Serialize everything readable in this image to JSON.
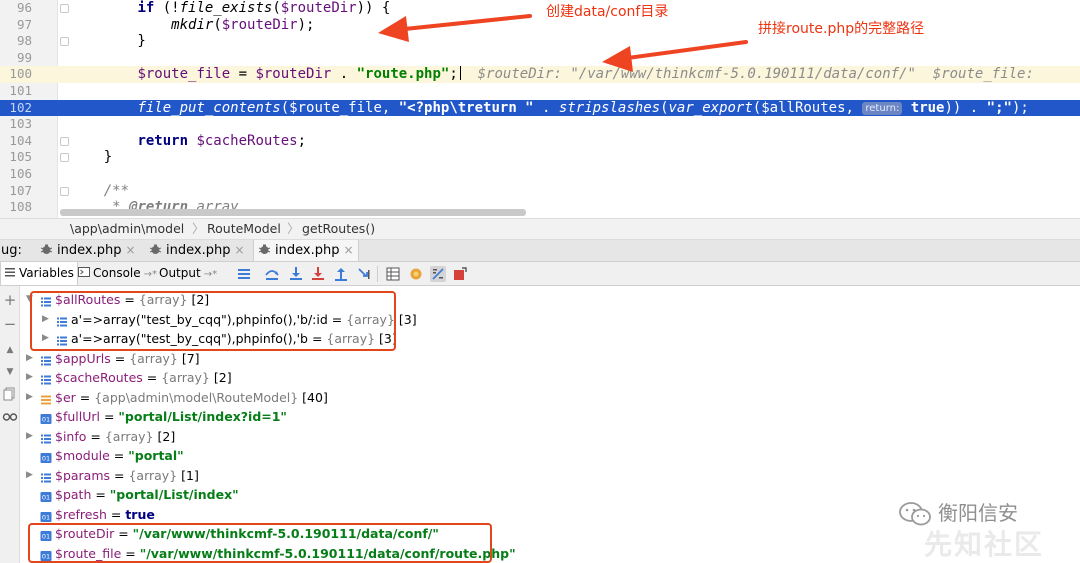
{
  "editor": {
    "lines": [
      {
        "num": "96",
        "style": "normal",
        "tokens": [
          {
            "t": "        ",
            "c": "plain"
          },
          {
            "t": "if",
            "c": "kw"
          },
          {
            "t": " (!",
            "c": "plain"
          },
          {
            "t": "file_exists",
            "c": "fn"
          },
          {
            "t": "(",
            "c": "plain"
          },
          {
            "t": "$routeDir",
            "c": "var"
          },
          {
            "t": ")) {",
            "c": "plain"
          }
        ]
      },
      {
        "num": "97",
        "style": "normal",
        "tokens": [
          {
            "t": "            ",
            "c": "plain"
          },
          {
            "t": "mkdir",
            "c": "fn"
          },
          {
            "t": "(",
            "c": "plain"
          },
          {
            "t": "$routeDir",
            "c": "var"
          },
          {
            "t": ");",
            "c": "plain"
          }
        ]
      },
      {
        "num": "98",
        "style": "normal",
        "tokens": [
          {
            "t": "        }",
            "c": "plain"
          }
        ]
      },
      {
        "num": "99",
        "style": "normal",
        "tokens": []
      },
      {
        "num": "100",
        "style": "exec",
        "tokens": [
          {
            "t": "        ",
            "c": "plain"
          },
          {
            "t": "$route_file",
            "c": "var"
          },
          {
            "t": " = ",
            "c": "plain"
          },
          {
            "t": "$routeDir",
            "c": "var"
          },
          {
            "t": " . ",
            "c": "plain"
          },
          {
            "t": "\"route.php\"",
            "c": "str"
          },
          {
            "t": ";",
            "c": "plain"
          },
          {
            "t": "",
            "c": "caret"
          },
          {
            "t": "  $routeDir: \"/var/www/thinkcmf-5.0.190111/data/conf/\"  $route_file: ",
            "c": "inline-hint"
          }
        ]
      },
      {
        "num": "101",
        "style": "normal",
        "tokens": []
      },
      {
        "num": "102",
        "style": "selected",
        "tokens": [
          {
            "t": "        ",
            "c": "plain"
          },
          {
            "t": "file_put_contents",
            "c": "fn"
          },
          {
            "t": "(",
            "c": "plain"
          },
          {
            "t": "$route_file",
            "c": "var"
          },
          {
            "t": ", ",
            "c": "plain"
          },
          {
            "t": "\"<?php\\treturn \"",
            "c": "str"
          },
          {
            "t": " . ",
            "c": "plain"
          },
          {
            "t": "stripslashes",
            "c": "fn"
          },
          {
            "t": "(",
            "c": "plain"
          },
          {
            "t": "var_export",
            "c": "fn"
          },
          {
            "t": "(",
            "c": "plain"
          },
          {
            "t": "$allRoutes",
            "c": "var"
          },
          {
            "t": ", ",
            "c": "plain"
          },
          {
            "t": "return:",
            "c": "param-hint"
          },
          {
            "t": " true",
            "c": "kw"
          },
          {
            "t": ")) . ",
            "c": "plain"
          },
          {
            "t": "\";\"",
            "c": "str"
          },
          {
            "t": ");",
            "c": "plain"
          }
        ]
      },
      {
        "num": "103",
        "style": "normal",
        "tokens": []
      },
      {
        "num": "104",
        "style": "normal",
        "tokens": [
          {
            "t": "        ",
            "c": "plain"
          },
          {
            "t": "return",
            "c": "kw"
          },
          {
            "t": " ",
            "c": "plain"
          },
          {
            "t": "$cacheRoutes",
            "c": "var"
          },
          {
            "t": ";",
            "c": "plain"
          }
        ]
      },
      {
        "num": "105",
        "style": "normal",
        "tokens": [
          {
            "t": "    }",
            "c": "plain"
          }
        ]
      },
      {
        "num": "106",
        "style": "normal",
        "tokens": []
      },
      {
        "num": "107",
        "style": "normal",
        "tokens": [
          {
            "t": "    /**",
            "c": "cm"
          }
        ]
      },
      {
        "num": "108",
        "style": "normal",
        "tokens": [
          {
            "t": "     * ",
            "c": "cm"
          },
          {
            "t": "@return",
            "c": "cmtag"
          },
          {
            "t": " array",
            "c": "cm"
          }
        ]
      }
    ]
  },
  "breadcrumb": {
    "items": [
      "\\app\\admin\\model",
      "RouteModel",
      "getRoutes()"
    ]
  },
  "debug": {
    "label": "ug:",
    "tabs": [
      {
        "label": "index.php",
        "active": false
      },
      {
        "label": "index.php",
        "active": false
      },
      {
        "label": "index.php",
        "active": true
      }
    ]
  },
  "toolbar": {
    "tabs": [
      {
        "label": "Variables",
        "active": true
      },
      {
        "label": "Console",
        "active": false
      },
      {
        "label": "Output",
        "active": false
      }
    ],
    "pin_glyph": "→*"
  },
  "variables": [
    {
      "depth": 0,
      "expanded": true,
      "icon": "array",
      "name": "$allRoutes",
      "eq": " = ",
      "type": "{array}",
      "count": " [2]"
    },
    {
      "depth": 1,
      "expanded": false,
      "icon": "array",
      "name": "a'=>array(\"test_by_cqq\"),phpinfo(),'b/:id",
      "eq": " = ",
      "type": "{array}",
      "count": " [3]",
      "plain_name": true
    },
    {
      "depth": 1,
      "expanded": false,
      "icon": "array",
      "name": "a'=>array(\"test_by_cqq\"),phpinfo(),'b",
      "eq": " = ",
      "type": "{array}",
      "count": " [3]",
      "plain_name": true
    },
    {
      "depth": 0,
      "expanded": false,
      "icon": "array",
      "name": "$appUrls",
      "eq": " = ",
      "type": "{array}",
      "count": " [7]"
    },
    {
      "depth": 0,
      "expanded": false,
      "icon": "array",
      "name": "$cacheRoutes",
      "eq": " = ",
      "type": "{array}",
      "count": " [2]"
    },
    {
      "depth": 0,
      "expanded": false,
      "icon": "object",
      "name": "$er",
      "eq": " = ",
      "type": "{app\\admin\\model\\RouteModel}",
      "count": " [40]"
    },
    {
      "depth": 0,
      "expanded": null,
      "icon": "scalar",
      "name": "$fullUrl",
      "eq": " = ",
      "str": "\"portal/List/index?id=1\""
    },
    {
      "depth": 0,
      "expanded": false,
      "icon": "array",
      "name": "$info",
      "eq": " = ",
      "type": "{array}",
      "count": " [2]"
    },
    {
      "depth": 0,
      "expanded": null,
      "icon": "scalar",
      "name": "$module",
      "eq": " = ",
      "str": "\"portal\""
    },
    {
      "depth": 0,
      "expanded": false,
      "icon": "array",
      "name": "$params",
      "eq": " = ",
      "type": "{array}",
      "count": " [1]"
    },
    {
      "depth": 0,
      "expanded": null,
      "icon": "scalar",
      "name": "$path",
      "eq": " = ",
      "str": "\"portal/List/index\""
    },
    {
      "depth": 0,
      "expanded": null,
      "icon": "scalar",
      "name": "$refresh",
      "eq": " = ",
      "bool": "true"
    },
    {
      "depth": 0,
      "expanded": null,
      "icon": "scalar",
      "name": "$routeDir",
      "eq": " = ",
      "str": "\"/var/www/thinkcmf-5.0.190111/data/conf/\""
    },
    {
      "depth": 0,
      "expanded": null,
      "icon": "scalar",
      "name": "$route_file",
      "eq": " = ",
      "str": "\"/var/www/thinkcmf-5.0.190111/data/conf/route.php\""
    }
  ],
  "annotations": {
    "mkdir_note": "创建data/conf目录",
    "route_note": "拼接route.php的完整路径",
    "color": "#e2471c"
  },
  "watermark": {
    "text": "衡阳信安",
    "text2": "先知社区"
  },
  "colors": {
    "selection": "#2157c9",
    "exec_line": "#fbf6dc",
    "variable": "#8a1e78",
    "string": "#067d17"
  }
}
